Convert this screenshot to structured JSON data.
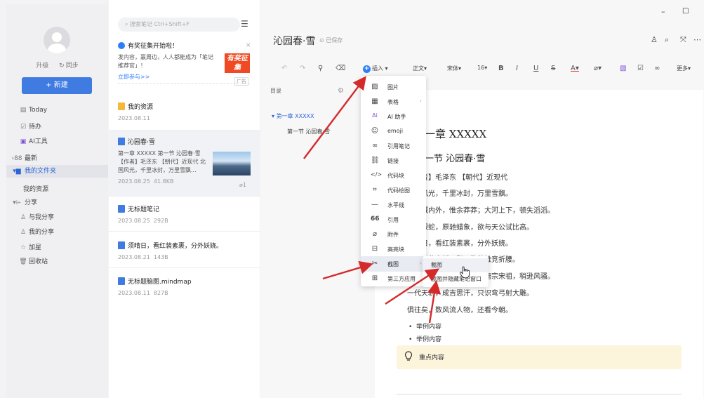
{
  "sidebar": {
    "upgrade": "升级",
    "sync": "同步",
    "new_button": "+ 新建",
    "items": [
      {
        "label": "Today",
        "icon": "▤"
      },
      {
        "label": "待办",
        "icon": "☑"
      },
      {
        "label": "AI工具",
        "icon": "▣"
      },
      {
        "label": "最新",
        "icon": "›88"
      },
      {
        "label": "我的文件夹",
        "icon": "▾▆"
      },
      {
        "label": "我的资源",
        "icon": ""
      },
      {
        "label": "分享",
        "icon": "▾⌲"
      },
      {
        "label": "与我分享",
        "icon": "♙"
      },
      {
        "label": "我的分享",
        "icon": "♙"
      },
      {
        "label": "加星",
        "icon": "☆"
      },
      {
        "label": "回收站",
        "icon": "🗑"
      }
    ]
  },
  "notes": {
    "search_placeholder": "搜索笔记 Ctrl+Shift+F",
    "ad": {
      "title": "有奖征集开始啦！",
      "body": "发内容，赢周边，人人都能成为「笔记推荐官」！",
      "badge": "有奖征集",
      "link": "立即参与>>",
      "tag": "广告"
    },
    "items": [
      {
        "title": "我的资源",
        "date": "2023.08.11",
        "snippet": "",
        "meta": ""
      },
      {
        "title": "沁园春·雪",
        "date": "2023.08.25",
        "size": "41.8KB",
        "snippet": "第一章 XXXXX 第一节 沁园春·雪【作者】毛泽东 【朝代】近现代 北国风光，千里冰封，万里雪飘...",
        "attach": "1"
      },
      {
        "title": "无标题笔记",
        "date": "2023.08.25",
        "size": "292B",
        "snippet": ""
      },
      {
        "title": "须晴日，看红装素裹，分外妖娆。",
        "date": "2023.08.21",
        "size": "143B",
        "snippet": ""
      },
      {
        "title": "无标题脑图.mindmap",
        "date": "2023.08.11",
        "size": "827B",
        "snippet": ""
      }
    ]
  },
  "editor": {
    "title": "沁园春·雪",
    "saved": "已保存",
    "toolbar": {
      "insert": "插入",
      "style": "正文",
      "font": "宋体",
      "size": "16",
      "more": "更多"
    },
    "toc": {
      "header": "目录",
      "chapter": "第一章 XXXXX",
      "section": "第一节 沁园春·雪"
    },
    "doc": {
      "chapter": "第一章 XXXXX",
      "section": "第一节 沁园春·雪",
      "lines": [
        "【作者】毛泽东 【朝代】近现代",
        "北国风光，千里冰封，万里雪飘。",
        "望长城内外，惟余莽莽；大河上下，顿失滔滔。",
        "山舞银蛇，原驰蜡象，欲与天公试比高。",
        "须晴日，看红装素裹，分外妖娆。",
        "江山如此多娇，引无数英雄竞折腰。",
        "惜秦皇汉武，略输文采；唐宗宋祖，稍逊风骚。",
        "一代天骄，成吉思汗，只识弯弓射大雕。",
        "俱往矣，数风流人物，还看今朝。"
      ],
      "bullets": [
        "举例内容",
        "举例内容"
      ],
      "callout": "重点内容"
    }
  },
  "insert_menu": {
    "items": [
      {
        "label": "图片",
        "icon": "▨"
      },
      {
        "label": "表格",
        "icon": "▦",
        "arrow": "›"
      },
      {
        "label": "AI 助手",
        "icon": "Ai"
      },
      {
        "label": "emoji",
        "icon": "☺"
      },
      {
        "label": "引用笔记",
        "icon": "∞"
      },
      {
        "label": "链接",
        "icon": "⛓"
      },
      {
        "label": "代码块",
        "icon": "</>"
      },
      {
        "label": "代码绘图",
        "icon": "⌗"
      },
      {
        "label": "水平线",
        "icon": "—"
      },
      {
        "label": "引用",
        "icon": "66"
      },
      {
        "label": "附件",
        "icon": "⌀"
      },
      {
        "label": "高亮块",
        "icon": "⊟"
      },
      {
        "label": "截图",
        "icon": "✂",
        "arrow": "›"
      },
      {
        "label": "第三方应用",
        "icon": "⊞"
      }
    ]
  },
  "screenshot_submenu": {
    "items": [
      "截图",
      "截图并隐藏笔记窗口"
    ]
  },
  "colors": {
    "accent": "#3f7be0",
    "arrow": "#d42a2a",
    "callout": "#fdf4dc"
  }
}
